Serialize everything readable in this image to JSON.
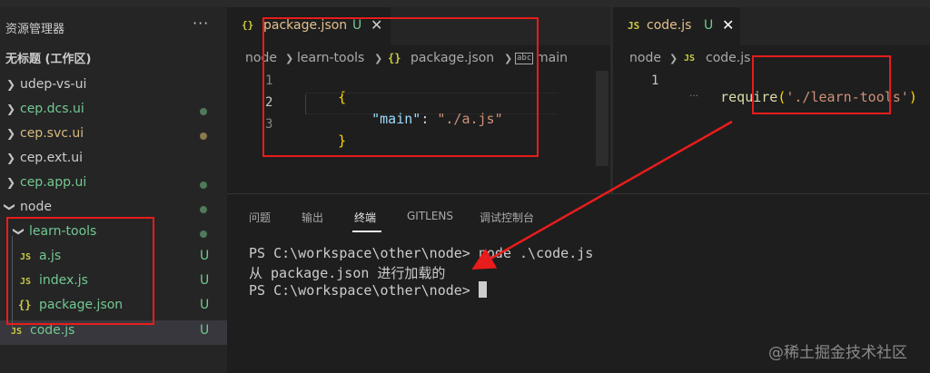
{
  "sidebar": {
    "title": "资源管理器",
    "more": "···",
    "workspace": "无标题 (工作区)",
    "items": [
      {
        "label": "udep-vs-ui",
        "status": ""
      },
      {
        "label": "cep.dcs.ui",
        "status": "dot-green"
      },
      {
        "label": "cep.svc.ui",
        "status": "dot-olive"
      },
      {
        "label": "cep.ext.ui",
        "status": ""
      },
      {
        "label": "cep.app.ui",
        "status": "dot-green"
      },
      {
        "label": "node",
        "status": "dot-green"
      },
      {
        "label": "learn-tools",
        "status": "dot-green"
      },
      {
        "label": "a.js",
        "status": "U",
        "icon": "JS"
      },
      {
        "label": "index.js",
        "status": "U",
        "icon": "JS"
      },
      {
        "label": "package.json",
        "status": "U",
        "icon": "{}"
      },
      {
        "label": "code.js",
        "status": "U",
        "icon": "JS"
      }
    ]
  },
  "editor1": {
    "tab": {
      "icon": "{}",
      "name": "package.json",
      "modified": "U",
      "close": "✕"
    },
    "breadcrumb": [
      "node",
      "learn-tools",
      "package.json",
      "main"
    ],
    "lines": [
      {
        "num": "1",
        "open": "{"
      },
      {
        "num": "2",
        "key": "\"main\"",
        "colon": ": ",
        "value": "\"./a.js\""
      },
      {
        "num": "3",
        "close": "}"
      }
    ]
  },
  "editor2": {
    "tab": {
      "icon": "JS",
      "name": "code.js",
      "modified": "U",
      "close": "✕"
    },
    "breadcrumb": [
      "node",
      "code.js"
    ],
    "line": {
      "num": "1",
      "fn": "require",
      "open": "(",
      "arg": "'./learn-tools'",
      "close": ")"
    }
  },
  "panel": {
    "tabs": [
      "问题",
      "输出",
      "终端",
      "GITLENS",
      "调试控制台"
    ],
    "active_tab": "终端",
    "terminal": [
      "PS C:\\workspace\\other\\node> node .\\code.js",
      "从 package.json 进行加载的",
      "PS C:\\workspace\\other\\node> "
    ]
  },
  "watermark": "@稀土掘金技术社区",
  "colors": {
    "annotation": "#e81c1c",
    "untracked": "#73c991",
    "folder_dot": "#4f7a5a"
  }
}
